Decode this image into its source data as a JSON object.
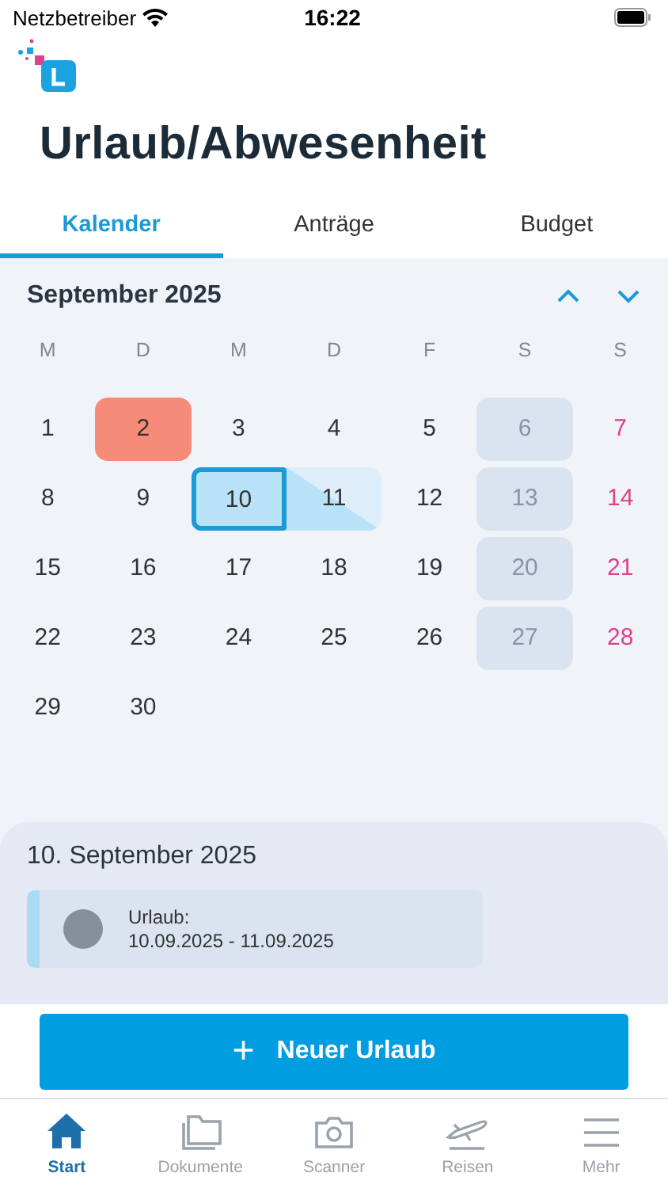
{
  "status_bar": {
    "carrier": "Netzbetreiber",
    "time": "16:22"
  },
  "title": "Urlaub/Abwesenheit",
  "tabs": [
    {
      "label": "Kalender",
      "selected": true
    },
    {
      "label": "Anträge",
      "selected": false
    },
    {
      "label": "Budget",
      "selected": false
    }
  ],
  "calendar": {
    "month": "September 2025",
    "weekdays": [
      "M",
      "D",
      "M",
      "D",
      "F",
      "S",
      "S"
    ],
    "days": [
      {
        "label": "1",
        "kind": "workday",
        "selected": false
      },
      {
        "label": "2",
        "kind": "sick",
        "selected": false
      },
      {
        "label": "3",
        "kind": "workday",
        "selected": false
      },
      {
        "label": "4",
        "kind": "workday",
        "selected": false
      },
      {
        "label": "5",
        "kind": "workday",
        "selected": false
      },
      {
        "label": "6",
        "kind": "saturday",
        "selected": false
      },
      {
        "label": "7",
        "kind": "sunday",
        "selected": false
      },
      {
        "label": "8",
        "kind": "workday",
        "selected": false
      },
      {
        "label": "9",
        "kind": "workday",
        "selected": false
      },
      {
        "label": "10",
        "kind": "vacation-start",
        "selected": true
      },
      {
        "label": "11",
        "kind": "vacation-end",
        "selected": false
      },
      {
        "label": "12",
        "kind": "workday",
        "selected": false
      },
      {
        "label": "13",
        "kind": "saturday",
        "selected": false
      },
      {
        "label": "14",
        "kind": "sunday",
        "selected": false
      },
      {
        "label": "15",
        "kind": "workday",
        "selected": false
      },
      {
        "label": "16",
        "kind": "workday",
        "selected": false
      },
      {
        "label": "17",
        "kind": "workday",
        "selected": false
      },
      {
        "label": "18",
        "kind": "workday",
        "selected": false
      },
      {
        "label": "19",
        "kind": "workday",
        "selected": false
      },
      {
        "label": "20",
        "kind": "saturday",
        "selected": false
      },
      {
        "label": "21",
        "kind": "sunday",
        "selected": false
      },
      {
        "label": "22",
        "kind": "workday",
        "selected": false
      },
      {
        "label": "23",
        "kind": "workday",
        "selected": false
      },
      {
        "label": "24",
        "kind": "workday",
        "selected": false
      },
      {
        "label": "25",
        "kind": "workday",
        "selected": false
      },
      {
        "label": "26",
        "kind": "workday",
        "selected": false
      },
      {
        "label": "27",
        "kind": "saturday",
        "selected": false
      },
      {
        "label": "28",
        "kind": "sunday",
        "selected": false
      },
      {
        "label": "29",
        "kind": "workday",
        "selected": false
      },
      {
        "label": "30",
        "kind": "workday",
        "selected": false
      }
    ]
  },
  "detail": {
    "date": "10. September 2025",
    "entries": [
      {
        "type": "Urlaub:",
        "range": "10.09.2025 - 11.09.2025"
      }
    ]
  },
  "new_button": {
    "icon": "+",
    "label": "Neuer Urlaub"
  },
  "nav": [
    {
      "label": "Start",
      "kind": "house",
      "selected": true
    },
    {
      "label": "Dokumente",
      "kind": "folder",
      "selected": false
    },
    {
      "label": "Scanner",
      "kind": "camera",
      "selected": false
    },
    {
      "label": "Reisen",
      "kind": "plane",
      "selected": false
    },
    {
      "label": "Mehr",
      "kind": "menu",
      "selected": false
    }
  ]
}
